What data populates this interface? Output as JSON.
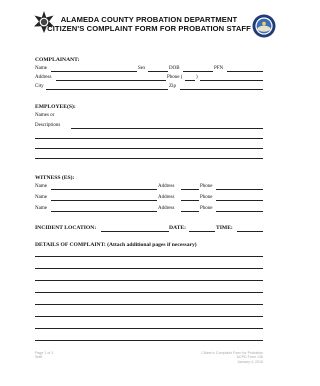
{
  "header": {
    "title_line1": "ALAMEDA COUNTY PROBATION DEPARTMENT",
    "title_line2": "CITIZEN'S COMPLAINT FORM FOR PROBATION STAFF"
  },
  "complainant": {
    "heading": "COMPLAINANT:",
    "name_label": "Name",
    "sex_label": "Sex",
    "dob_label": "DOB",
    "pfn_label": "PFN",
    "address_label": "Address",
    "phone_label": "Phone (",
    "phone_close": ")",
    "city_label": "City",
    "zip_label": "Zip"
  },
  "employees": {
    "heading": "EMPLOYEE(S):",
    "names_label": "Names or",
    "descriptions_label": "Descriptions"
  },
  "witness": {
    "heading": "WITNESS (ES):",
    "rows": [
      {
        "name": "Name",
        "address": "Address",
        "phone": "Phone"
      },
      {
        "name": "Name",
        "address": "Address",
        "phone": "Phone"
      },
      {
        "name": "Name",
        "address": "Address",
        "phone": "Phone"
      }
    ]
  },
  "incident": {
    "location_label": "INCIDENT LOCATION:",
    "date_label": "DATE:",
    "time_label": "TIME:"
  },
  "details": {
    "heading": "DETAILS OF COMPLAINT: (Attach additional pages if necessary)"
  },
  "footer": {
    "page": "Page 1 of 1",
    "left_sub": "Staff",
    "form_title": "Citizen's Complaint Form for Probation",
    "form_number": "ACPD Form 136",
    "form_date": "January 4, 2016"
  }
}
